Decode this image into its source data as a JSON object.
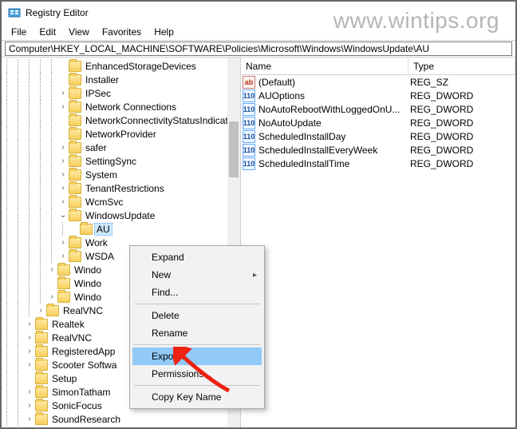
{
  "watermark": "www.wintips.org",
  "window": {
    "title": "Registry Editor"
  },
  "menubar": [
    "File",
    "Edit",
    "View",
    "Favorites",
    "Help"
  ],
  "address": {
    "value": "Computer\\HKEY_LOCAL_MACHINE\\SOFTWARE\\Policies\\Microsoft\\Windows\\WindowsUpdate\\AU"
  },
  "tree": [
    {
      "d": 5,
      "e": " ",
      "l": "EnhancedStorageDevices"
    },
    {
      "d": 5,
      "e": " ",
      "l": "Installer"
    },
    {
      "d": 5,
      "e": ">",
      "l": "IPSec"
    },
    {
      "d": 5,
      "e": ">",
      "l": "Network Connections"
    },
    {
      "d": 5,
      "e": " ",
      "l": "NetworkConnectivityStatusIndicator"
    },
    {
      "d": 5,
      "e": " ",
      "l": "NetworkProvider"
    },
    {
      "d": 5,
      "e": ">",
      "l": "safer"
    },
    {
      "d": 5,
      "e": ">",
      "l": "SettingSync"
    },
    {
      "d": 5,
      "e": ">",
      "l": "System"
    },
    {
      "d": 5,
      "e": ">",
      "l": "TenantRestrictions"
    },
    {
      "d": 5,
      "e": ">",
      "l": "WcmSvc"
    },
    {
      "d": 5,
      "e": "v",
      "l": "WindowsUpdate"
    },
    {
      "d": 6,
      "e": " ",
      "l": "AU",
      "sel": true
    },
    {
      "d": 5,
      "e": ">",
      "l": "Work"
    },
    {
      "d": 5,
      "e": ">",
      "l": "WSDA"
    },
    {
      "d": 4,
      "e": ">",
      "l": "Windo"
    },
    {
      "d": 4,
      "e": " ",
      "l": "Windo"
    },
    {
      "d": 4,
      "e": ">",
      "l": "Windo"
    },
    {
      "d": 3,
      "e": ">",
      "l": "RealVNC"
    },
    {
      "d": 2,
      "e": ">",
      "l": "Realtek"
    },
    {
      "d": 2,
      "e": ">",
      "l": "RealVNC"
    },
    {
      "d": 2,
      "e": ">",
      "l": "RegisteredApp"
    },
    {
      "d": 2,
      "e": ">",
      "l": "Scooter Softwa"
    },
    {
      "d": 2,
      "e": " ",
      "l": "Setup"
    },
    {
      "d": 2,
      "e": ">",
      "l": "SimonTatham"
    },
    {
      "d": 2,
      "e": ">",
      "l": "SonicFocus"
    },
    {
      "d": 2,
      "e": ">",
      "l": "SoundResearch"
    }
  ],
  "list": {
    "columns": {
      "name": "Name",
      "type": "Type"
    },
    "rows": [
      {
        "icon": "str",
        "name": "(Default)",
        "type": "REG_SZ"
      },
      {
        "icon": "dw",
        "name": "AUOptions",
        "type": "REG_DWORD"
      },
      {
        "icon": "dw",
        "name": "NoAutoRebootWithLoggedOnU...",
        "type": "REG_DWORD"
      },
      {
        "icon": "dw",
        "name": "NoAutoUpdate",
        "type": "REG_DWORD"
      },
      {
        "icon": "dw",
        "name": "ScheduledInstallDay",
        "type": "REG_DWORD"
      },
      {
        "icon": "dw",
        "name": "ScheduledInstallEveryWeek",
        "type": "REG_DWORD"
      },
      {
        "icon": "dw",
        "name": "ScheduledInstallTime",
        "type": "REG_DWORD"
      }
    ]
  },
  "context_menu": [
    {
      "label": "Expand"
    },
    {
      "label": "New",
      "sub": true
    },
    {
      "label": "Find..."
    },
    {
      "sep": true
    },
    {
      "label": "Delete"
    },
    {
      "label": "Rename"
    },
    {
      "sep": true
    },
    {
      "label": "Export...",
      "hl": true
    },
    {
      "label": "Permissions..."
    },
    {
      "sep": true
    },
    {
      "label": "Copy Key Name"
    }
  ]
}
